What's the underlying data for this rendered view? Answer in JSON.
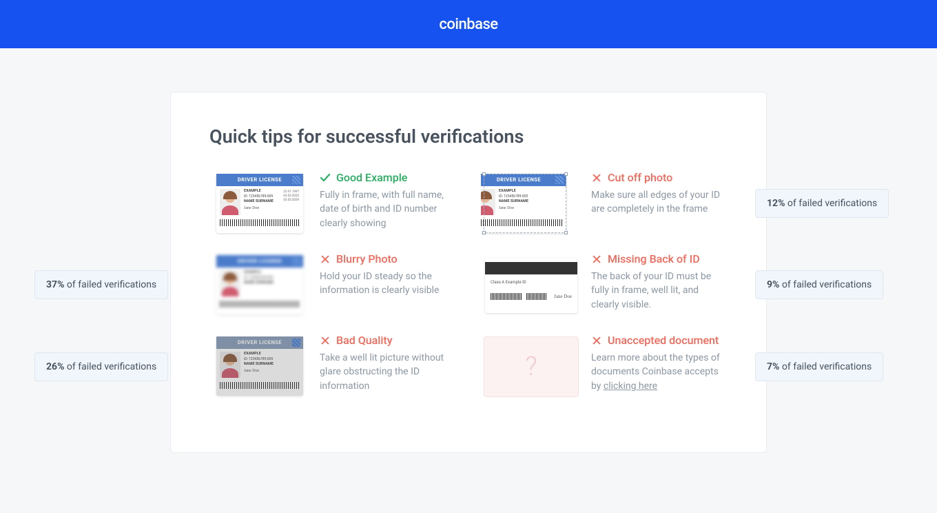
{
  "brand": "coinbase",
  "title": "Quick tips for successful verifications",
  "tips": {
    "good": {
      "label": "Good Example",
      "desc": "Fully in frame, with full name, date of birth and ID number clearly showing"
    },
    "blurry": {
      "label": "Blurry Photo",
      "desc": "Hold your ID steady so the information is clearly visible"
    },
    "bad": {
      "label": "Bad Quality",
      "desc": "Take a well lit picture without glare obstructing the ID information"
    },
    "cutoff": {
      "label": "Cut off photo",
      "desc": "Make sure all edges of your ID are completely in the frame"
    },
    "missing": {
      "label": "Missing Back of ID",
      "desc": "The back of your ID must be fully in frame, well lit, and clearly visible."
    },
    "unaccepted": {
      "label": "Unaccepted document",
      "desc_prefix": "Learn more about the types of documents Coinbase accepts by ",
      "link": "clicking here"
    }
  },
  "idcard": {
    "header": "DRIVER LICENSE",
    "example_word": "EXAMPLE",
    "id_line": "ID: 123456789-005",
    "name_line": "NAME SURNAME",
    "back_label": "Class A Example ID",
    "signature": "Jane Doe",
    "detail_lines": [
      "23.01.1997",
      "03.03.2022",
      "03.05.2029"
    ]
  },
  "annotations": {
    "blurry": {
      "pct": "37%",
      "suffix": "of failed verifications"
    },
    "bad": {
      "pct": "26%",
      "suffix": "of failed verifications"
    },
    "cutoff": {
      "pct": "12%",
      "suffix": "of failed verifications"
    },
    "missing": {
      "pct": "9%",
      "suffix": "of failed verifications"
    },
    "unaccepted": {
      "pct": "7%",
      "suffix": "of failed verifications"
    }
  }
}
